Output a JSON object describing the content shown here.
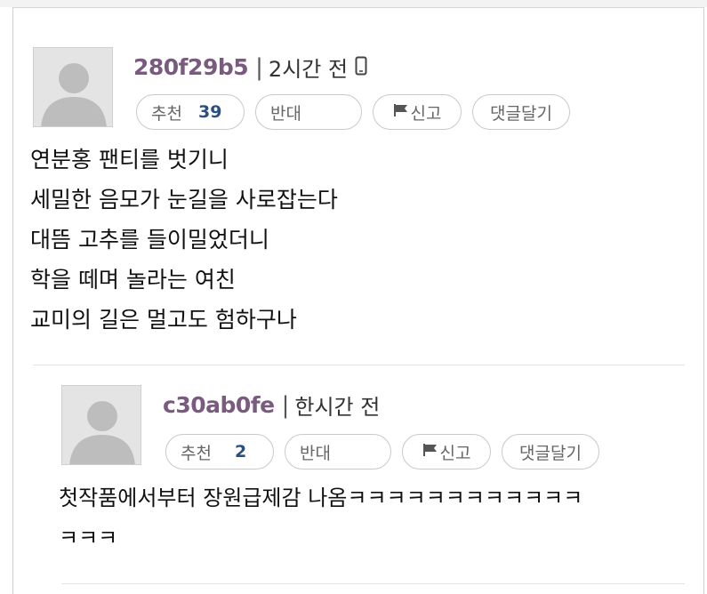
{
  "comments": [
    {
      "username": "280f29b5",
      "separator": "|",
      "time": "2시간 전",
      "device_icon": "mobile-phone-icon",
      "buttons": {
        "like_label": "추천",
        "like_count": "39",
        "oppose_label": "반대",
        "report_label": "신고",
        "reply_label": "댓글달기"
      },
      "lines": [
        "연분홍 팬티를 벗기니",
        "세밀한 음모가 눈길을 사로잡는다",
        "대뜸 고추를 들이밀었더니",
        "학을 떼며 놀라는 여친",
        "교미의 길은 멀고도 험하구나"
      ]
    },
    {
      "username": "c30ab0fe",
      "separator": "|",
      "time": "한시간 전",
      "buttons": {
        "like_label": "추천",
        "like_count": "2",
        "oppose_label": "반대",
        "report_label": "신고",
        "reply_label": "댓글달기"
      },
      "lines": [
        "첫작품에서부터 장원급제감 나옴ㅋㅋㅋㅋㅋㅋㅋㅋㅋㅋㅋㅋ",
        "ㅋㅋㅋ"
      ]
    }
  ],
  "colors": {
    "username": "#7a5a7f",
    "count": "#2a4f80",
    "border": "#c9c9c9"
  }
}
